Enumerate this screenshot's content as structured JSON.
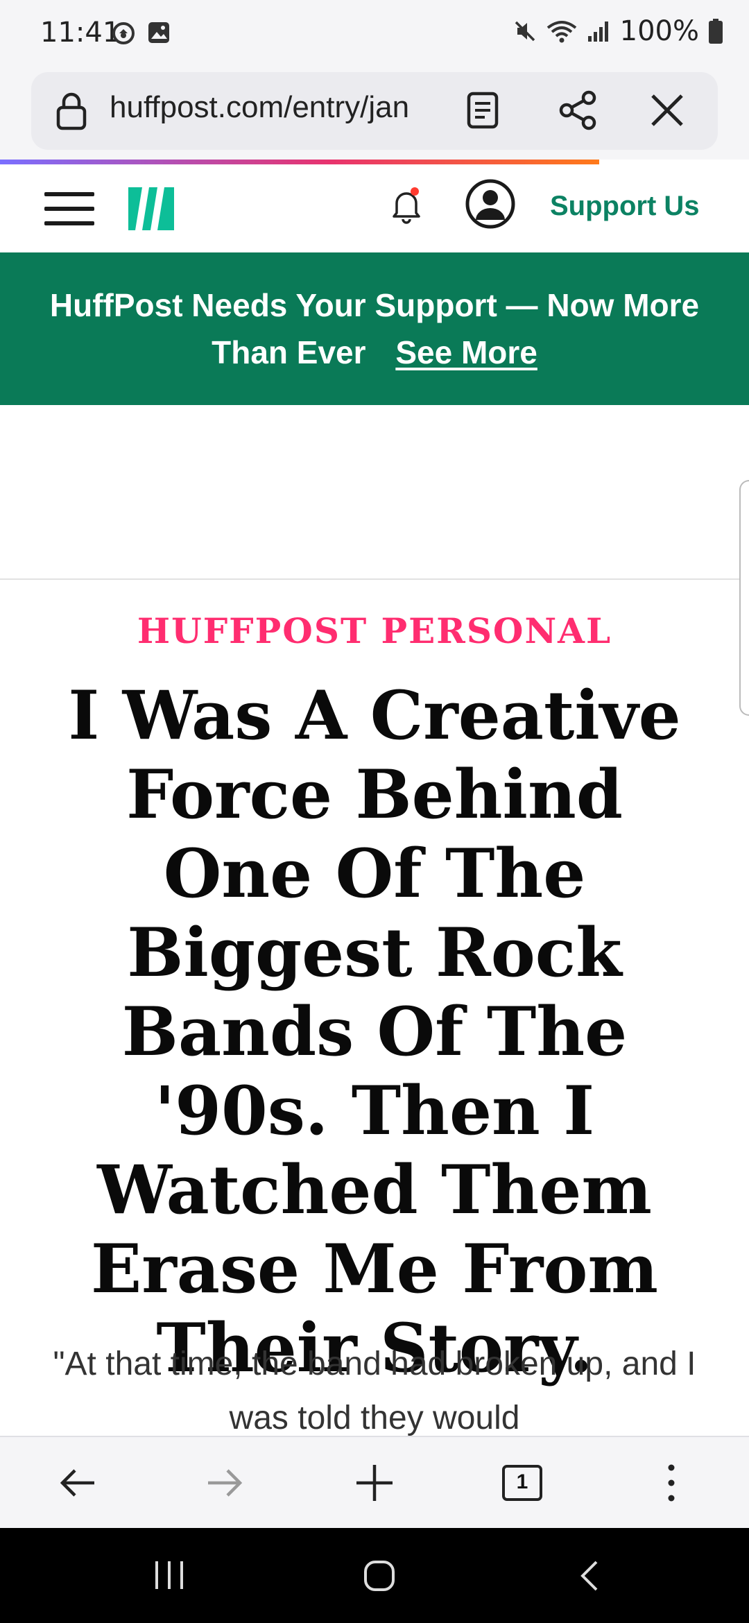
{
  "status_bar": {
    "time": "11:41",
    "battery": "100%",
    "icons": [
      "sync-icon",
      "image-icon",
      "mute-icon",
      "wifi-icon",
      "signal-icon",
      "battery-icon"
    ]
  },
  "browser": {
    "url": "huffpost.com/entry/jan",
    "icons": [
      "lock-icon",
      "reader-mode-icon",
      "share-icon",
      "close-icon"
    ],
    "page_load_progress": 0.8
  },
  "site_header": {
    "support_label": "Support Us",
    "brand_color": "#0c8263"
  },
  "banner": {
    "text": "HuffPost Needs Your Support — Now More Than Ever",
    "link_label": "See More",
    "background": "#0a7a57"
  },
  "article": {
    "kicker": "HUFFPOST PERSONAL",
    "kicker_color": "#ff2d70",
    "headline": "I Was A Creative Force Behind One Of The Biggest Rock Bands Of The '90s. Then I Watched Them Erase Me From Their Story.",
    "dek": "\"At that time, the band had broken up, and I was told they would"
  },
  "toolbar": {
    "tab_count": "1",
    "icons": [
      "back-arrow-icon",
      "forward-arrow-icon",
      "plus-icon",
      "tabs-icon",
      "more-vert-icon"
    ]
  },
  "nav_bar": {
    "icons": [
      "recents-icon",
      "home-icon",
      "back-icon"
    ]
  }
}
